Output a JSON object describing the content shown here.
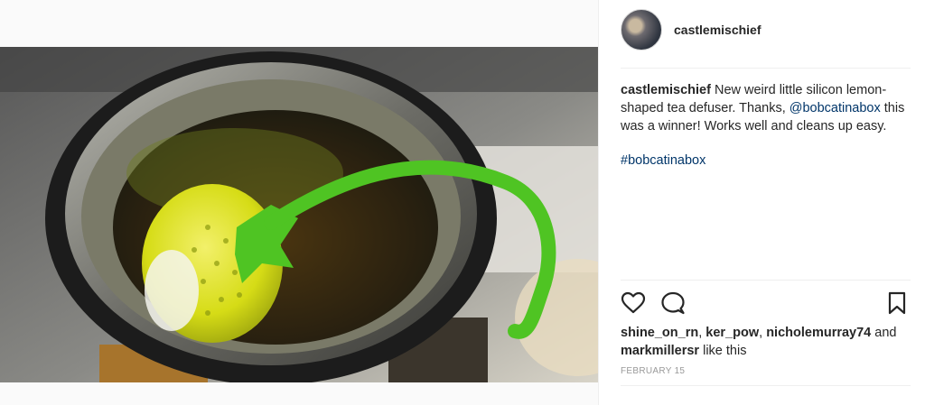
{
  "post": {
    "username": "castlemischief",
    "caption": {
      "username": "castlemischief",
      "text_before_mention": " New weird little silicon lemon-shaped tea defuser. Thanks, ",
      "mention": "@bobcatinabox",
      "text_after_mention": " this was a winner! Works well and cleans up easy.",
      "hashtag": "#bobcatinabox"
    },
    "likes": {
      "user1": "shine_on_rn",
      "sep1": ", ",
      "user2": "ker_pow",
      "sep2": ", ",
      "user3": "nicholemurray74",
      "and_text": " and",
      "user4": "markmillersr",
      "suffix": " like this"
    },
    "date": "FEBRUARY 15"
  },
  "icons": {
    "like": "heart-icon",
    "comment": "comment-icon",
    "save": "bookmark-icon"
  },
  "colors": {
    "link": "#003569",
    "text": "#262626",
    "muted": "#999999",
    "infuser_green": "#4fc423",
    "lemon_yellow": "#e2e61a"
  }
}
